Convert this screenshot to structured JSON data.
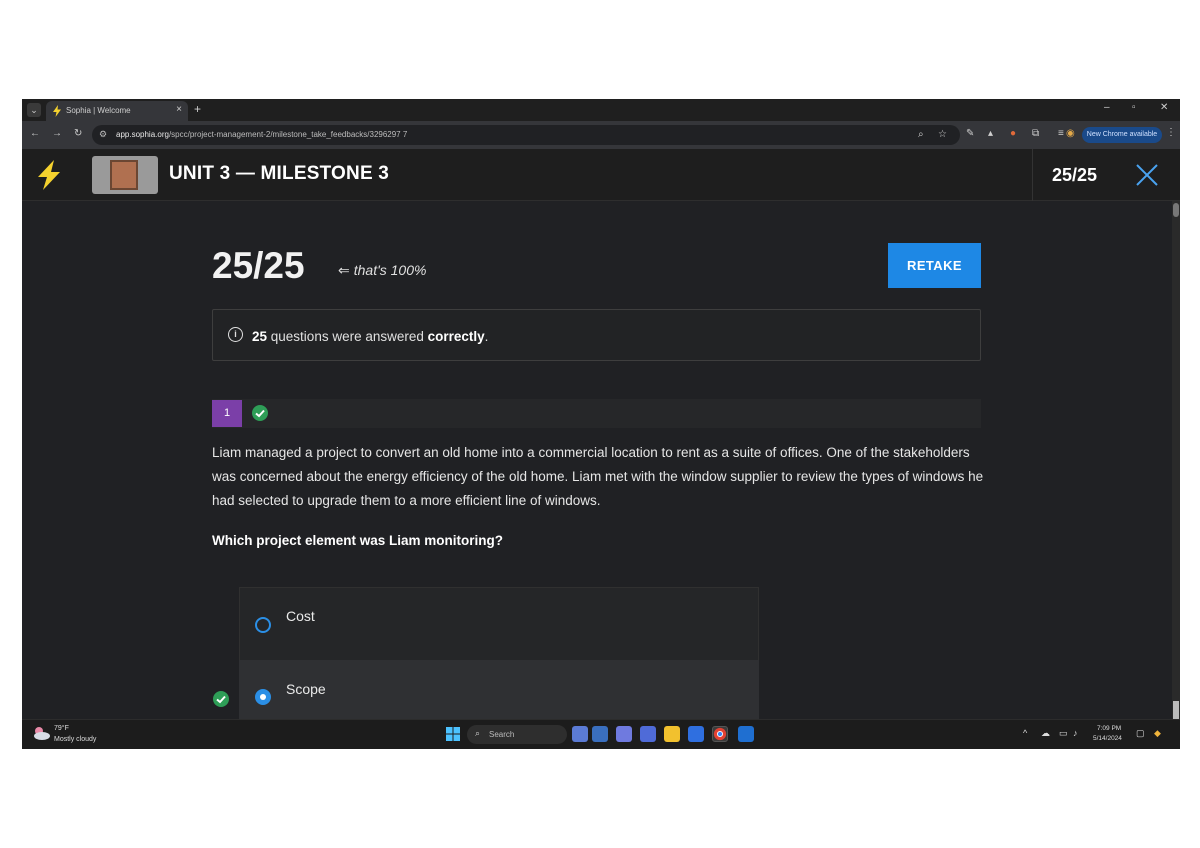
{
  "browser": {
    "tab_title": "Sophia | Welcome",
    "url_host": "app.sophia.org",
    "url_path": "/spcc/project-management-2/milestone_take_feedbacks/3296297 7",
    "new_chrome_label": "New Chrome available"
  },
  "header": {
    "unit_title": "UNIT 3 — MILESTONE 3",
    "score": "25/25"
  },
  "result": {
    "score": "25/25",
    "note": "that's 100%",
    "retake_label": "RETAKE",
    "info_count": "25",
    "info_mid": " questions were answered ",
    "info_bold": "correctly",
    "info_end": "."
  },
  "question": {
    "number": "1",
    "status": "correct",
    "text": "Liam managed a project to convert an old home into a commercial location to rent as a suite of offices. One of the stakeholders was concerned about the energy efficiency of the old home. Liam met with the window supplier to review the types of windows he had selected to upgrade them to a more efficient line of windows.",
    "prompt": "Which project element was Liam monitoring?",
    "options": [
      {
        "label": "Cost",
        "selected": false
      },
      {
        "label": "Scope",
        "selected": true,
        "correct": true
      }
    ]
  },
  "taskbar": {
    "weather_temp": "79°F",
    "weather_desc": "Mostly cloudy",
    "search_placeholder": "Search",
    "time": "7:09 PM",
    "date": "5/14/2024"
  },
  "colors": {
    "accent": "#1e88e5",
    "question_badge": "#7b3fa8",
    "correct": "#2e9e57",
    "logo": "#f5d22e"
  }
}
